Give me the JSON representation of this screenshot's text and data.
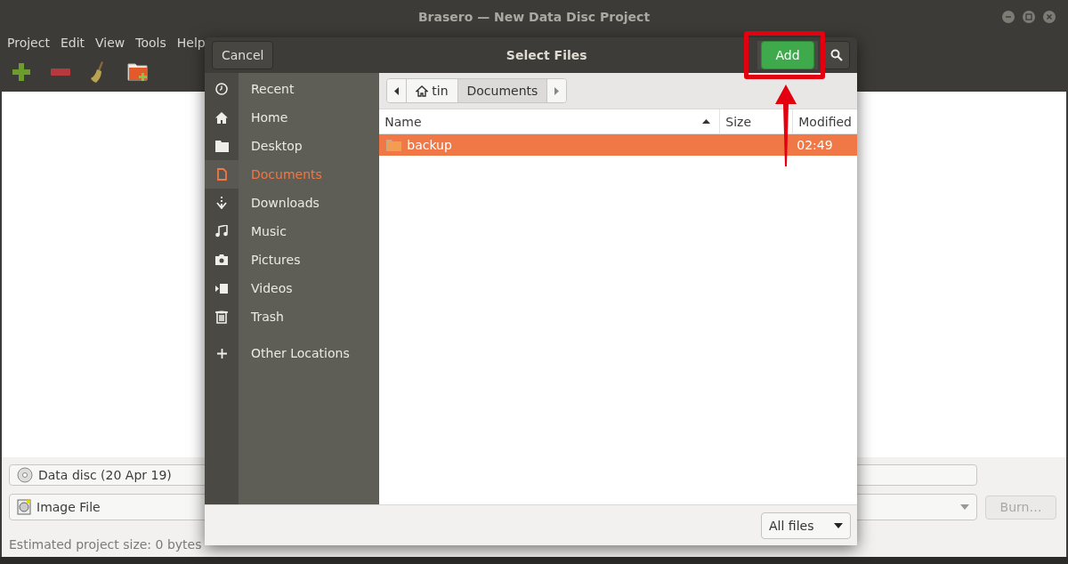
{
  "window": {
    "title": "Brasero — New Data Disc Project",
    "menu": [
      "Project",
      "Edit",
      "View",
      "Tools",
      "Help"
    ]
  },
  "disc_selector": {
    "value": "Data disc (20 Apr 19)"
  },
  "image_selector": {
    "value": "Image File"
  },
  "burn_button": {
    "label": "Burn…",
    "disabled": true
  },
  "status": "Estimated project size: 0 bytes",
  "dialog": {
    "title": "Select Files",
    "cancel": "Cancel",
    "add": "Add",
    "places": [
      {
        "label": "Recent",
        "kind": "recent",
        "selected": false
      },
      {
        "label": "Home",
        "kind": "home",
        "selected": false
      },
      {
        "label": "Desktop",
        "kind": "desktop",
        "selected": false
      },
      {
        "label": "Documents",
        "kind": "document",
        "selected": true
      },
      {
        "label": "Downloads",
        "kind": "download",
        "selected": false
      },
      {
        "label": "Music",
        "kind": "music",
        "selected": false
      },
      {
        "label": "Pictures",
        "kind": "camera",
        "selected": false
      },
      {
        "label": "Videos",
        "kind": "video",
        "selected": false
      },
      {
        "label": "Trash",
        "kind": "trash",
        "selected": false
      }
    ],
    "other_locations": "Other Locations",
    "path": [
      {
        "label": "tin",
        "kind": "home",
        "selected": false
      },
      {
        "label": "Documents",
        "kind": "folder",
        "selected": true
      }
    ],
    "columns": [
      "Name",
      "Size",
      "Modified"
    ],
    "rows": [
      {
        "name": "backup",
        "modified": "02:49",
        "selected": true
      }
    ],
    "filter": "All files"
  }
}
